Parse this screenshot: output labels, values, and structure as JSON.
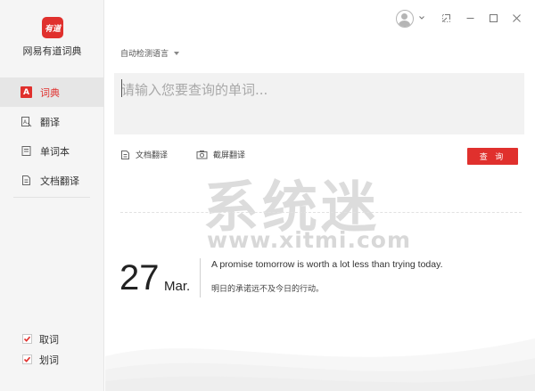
{
  "app": {
    "logo_text": "有道",
    "name": "网易有道词典"
  },
  "sidebar": {
    "items": [
      {
        "label": "词典",
        "icon": "dictionary-icon",
        "active": true
      },
      {
        "label": "翻译",
        "icon": "translate-icon",
        "active": false
      },
      {
        "label": "单词本",
        "icon": "wordbook-icon",
        "active": false
      },
      {
        "label": "文档翻译",
        "icon": "document-icon",
        "active": false
      }
    ],
    "options": [
      {
        "label": "取词",
        "checked": true
      },
      {
        "label": "划词",
        "checked": true
      }
    ]
  },
  "titlebar": {
    "icons": [
      "avatar-icon",
      "chevron-down-icon",
      "pin-icon",
      "minimize-icon",
      "maximize-icon",
      "close-icon"
    ]
  },
  "search": {
    "language_label": "自动检测语言",
    "placeholder": "请输入您要查询的单词..."
  },
  "tools": {
    "doc_translate": "文档翻译",
    "screenshot_translate": "截屏翻译",
    "query_button": "查 询"
  },
  "daily": {
    "day": "27",
    "month": "Mar.",
    "quote_en": "A promise tomorrow is worth a lot less than trying today.",
    "quote_cn": "明日的承诺远不及今日的行动。"
  },
  "watermark": {
    "text": "系统迷",
    "url": "www.xitmi.com"
  },
  "colors": {
    "accent": "#e0302d",
    "sidebar_bg": "#f5f5f5",
    "search_bg": "#f2f2f2"
  }
}
